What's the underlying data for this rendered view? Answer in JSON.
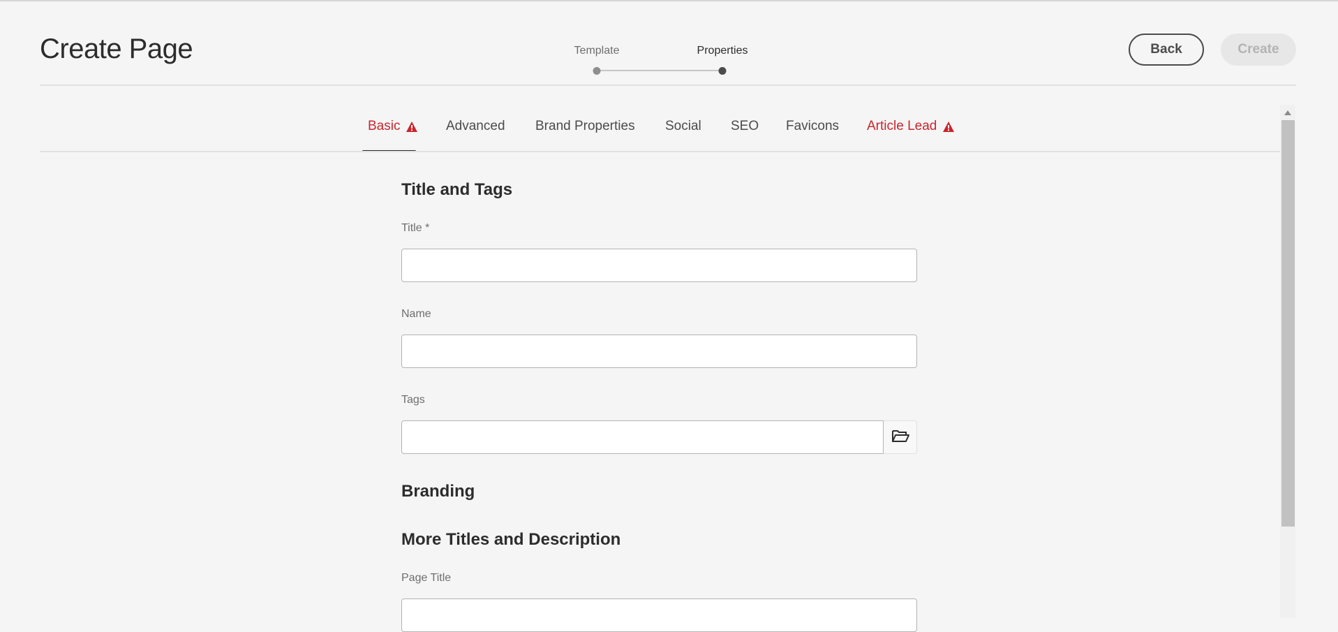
{
  "header": {
    "title": "Create Page",
    "wizard": {
      "steps": [
        "Template",
        "Properties"
      ],
      "current_step": 2
    },
    "back_label": "Back",
    "create_label": "Create"
  },
  "tabs": [
    {
      "label": "Basic",
      "active": true,
      "error": true
    },
    {
      "label": "Advanced",
      "active": false,
      "error": false
    },
    {
      "label": "Brand Properties",
      "active": false,
      "error": false
    },
    {
      "label": "Social",
      "active": false,
      "error": false
    },
    {
      "label": "SEO",
      "active": false,
      "error": false
    },
    {
      "label": "Favicons",
      "active": false,
      "error": false
    },
    {
      "label": "Article Lead",
      "active": false,
      "error": true
    }
  ],
  "form": {
    "section_title_tags": "Title and Tags",
    "title_label": "Title *",
    "title_value": "",
    "name_label": "Name",
    "name_value": "",
    "tags_label": "Tags",
    "tags_value": "",
    "section_branding": "Branding",
    "section_more_titles": "More Titles and Description",
    "page_title_label": "Page Title",
    "page_title_value": ""
  },
  "colors": {
    "error": "#c9252d",
    "background": "#f5f5f5",
    "text": "#2c2c2c"
  },
  "icons": {
    "tab_warning": "alert-triangle-icon",
    "tags_browse": "folder-open-icon",
    "scroll_up": "triangle-up-icon"
  }
}
